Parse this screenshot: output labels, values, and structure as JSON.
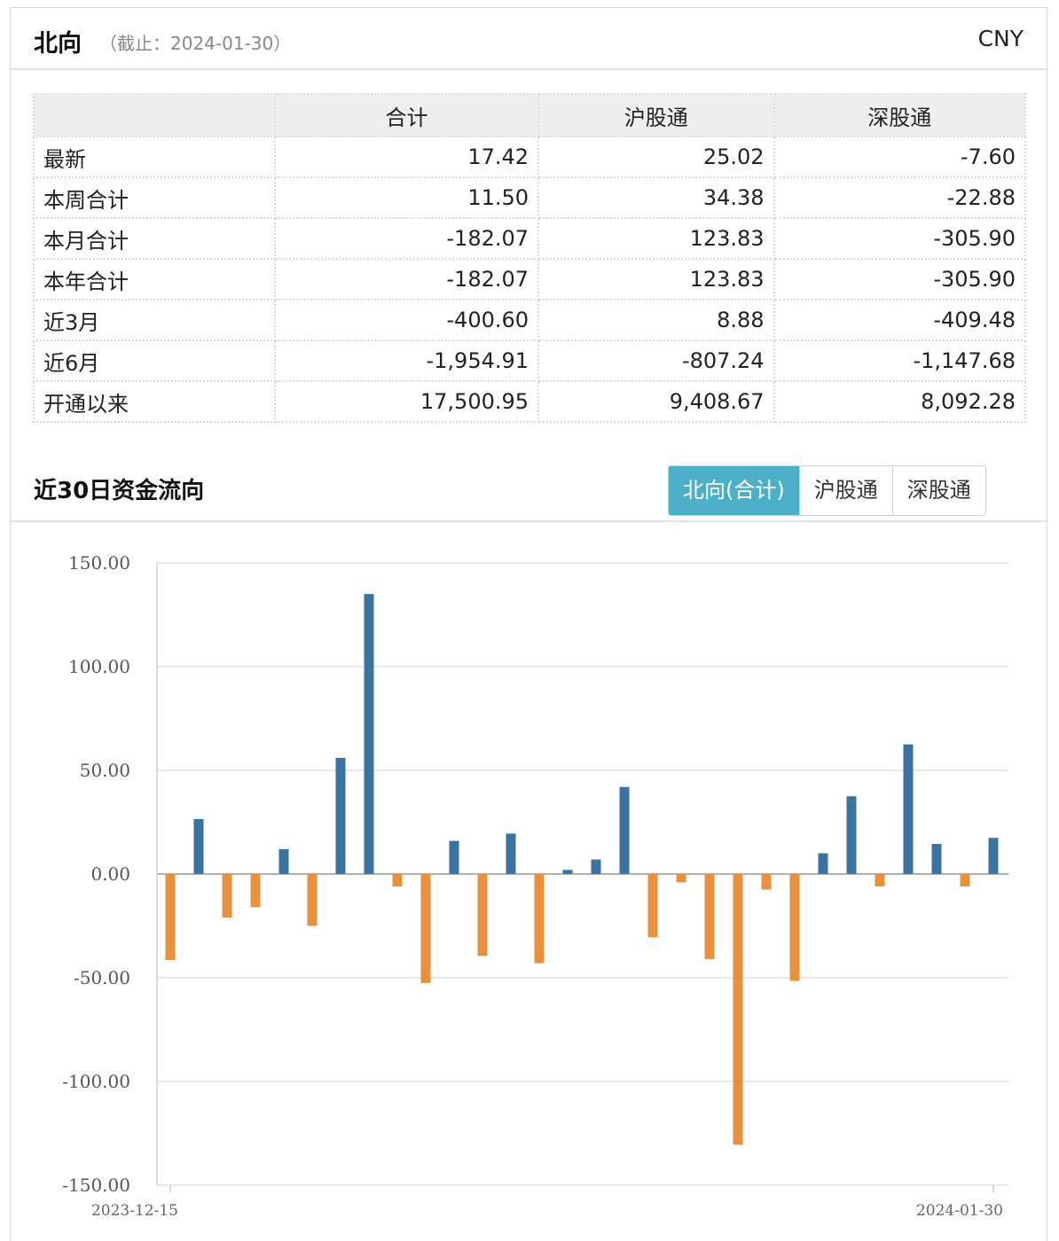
{
  "header": {
    "title": "北向",
    "subtitle": "（截止：2024-01-30）",
    "currency": "CNY"
  },
  "summary_table": {
    "columns": [
      "",
      "合计",
      "沪股通",
      "深股通"
    ],
    "rows": [
      {
        "label": "最新",
        "total": "17.42",
        "sh": "25.02",
        "sz": "-7.60"
      },
      {
        "label": "本周合计",
        "total": "11.50",
        "sh": "34.38",
        "sz": "-22.88"
      },
      {
        "label": "本月合计",
        "total": "-182.07",
        "sh": "123.83",
        "sz": "-305.90"
      },
      {
        "label": "本年合计",
        "total": "-182.07",
        "sh": "123.83",
        "sz": "-305.90"
      },
      {
        "label": "近3月",
        "total": "-400.60",
        "sh": "8.88",
        "sz": "-409.48"
      },
      {
        "label": "近6月",
        "total": "-1,954.91",
        "sh": "-807.24",
        "sz": "-1,147.68"
      },
      {
        "label": "开通以来",
        "total": "17,500.95",
        "sh": "9,408.67",
        "sz": "8,092.28"
      }
    ]
  },
  "flow_section": {
    "title": "近30日资金流向",
    "tabs": [
      {
        "label": "北向(合计)",
        "active": true
      },
      {
        "label": "沪股通",
        "active": false
      },
      {
        "label": "深股通",
        "active": false
      }
    ]
  },
  "chart_data": {
    "type": "bar",
    "x_start_label": "2023-12-15",
    "x_end_label": "2024-01-30",
    "yticks": [
      "150.00",
      "100.00",
      "50.00",
      "0.00",
      "-50.00",
      "-100.00",
      "-150.00"
    ],
    "ylim": [
      -150,
      150
    ],
    "grid": true,
    "positive_color": "#3b74a0",
    "negative_color": "#e8913a",
    "values": [
      -41.5,
      26.5,
      -21,
      -16,
      12,
      -25,
      56,
      135,
      -6,
      -52.5,
      16,
      -39.5,
      19.5,
      -43,
      2,
      7,
      42,
      -30.5,
      -4,
      -41,
      -130.5,
      -7.5,
      -51.5,
      10,
      37.5,
      -6,
      62.5,
      14.5,
      -6,
      17.42
    ]
  }
}
